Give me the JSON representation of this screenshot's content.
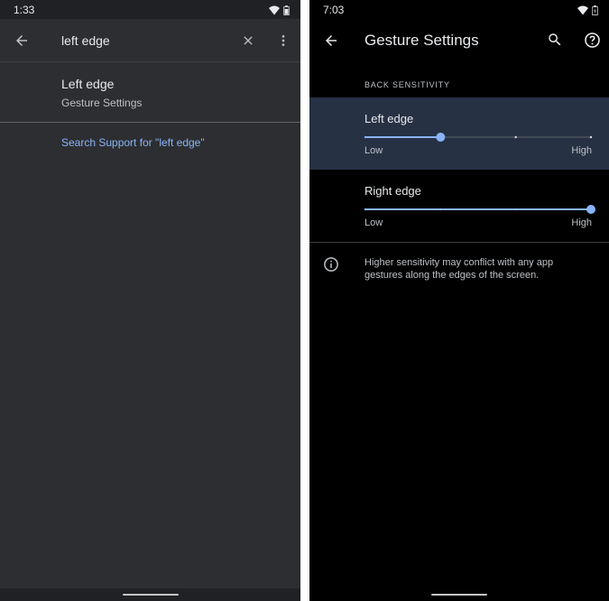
{
  "left_screen": {
    "status": {
      "time": "1:33"
    },
    "search": {
      "query": "left edge"
    },
    "result": {
      "title": "Left edge",
      "subtitle": "Gesture Settings"
    },
    "support_link": "Search Support for \"left edge\""
  },
  "right_screen": {
    "status": {
      "time": "7:03"
    },
    "title": "Gesture Settings",
    "section_label": "BACK SENSITIVITY",
    "sliders": [
      {
        "label": "Left edge",
        "low": "Low",
        "high": "High",
        "steps": 4,
        "value_step": 1
      },
      {
        "label": "Right edge",
        "low": "Low",
        "high": "High",
        "steps": 4,
        "value_step": 3
      }
    ],
    "info_text": "Higher sensitivity may conflict with any app gestures along the edges of the screen."
  },
  "colors": {
    "accent": "#8ab4f8",
    "left_background": "#2d2e31",
    "right_background": "#000000",
    "highlight_row": "#263144"
  },
  "icons": [
    "wifi-icon",
    "battery-icon",
    "back-arrow-icon",
    "close-icon",
    "more-vert-icon",
    "search-icon",
    "help-icon",
    "info-icon"
  ]
}
